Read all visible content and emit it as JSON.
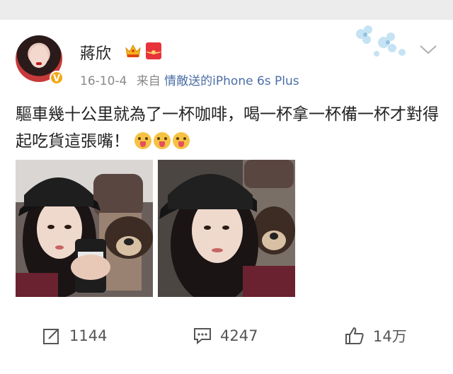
{
  "post": {
    "author": "蔣欣",
    "date": "16-10-4",
    "source_prefix": "来自",
    "source_device": "情敵送的iPhone 6s Plus",
    "text": "驅車幾十公里就為了一杯咖啡，喝一杯拿一杯備一杯才對得起吃貨這張嘴！",
    "verified_badge": "V"
  },
  "actions": {
    "repost_count": "1144",
    "comment_count": "4247",
    "like_count": "14万"
  },
  "icons": {
    "crown": "crown-icon",
    "red_packet": "red-packet-icon",
    "more": "chevron-down-icon",
    "repost": "share-icon",
    "comment": "comment-icon",
    "like": "thumbs-up-icon",
    "emoji": "tongue-out-emoji-icon"
  },
  "colors": {
    "link": "#4b6ea6",
    "badge": "#f4a712",
    "meta": "#8a8a8a"
  }
}
